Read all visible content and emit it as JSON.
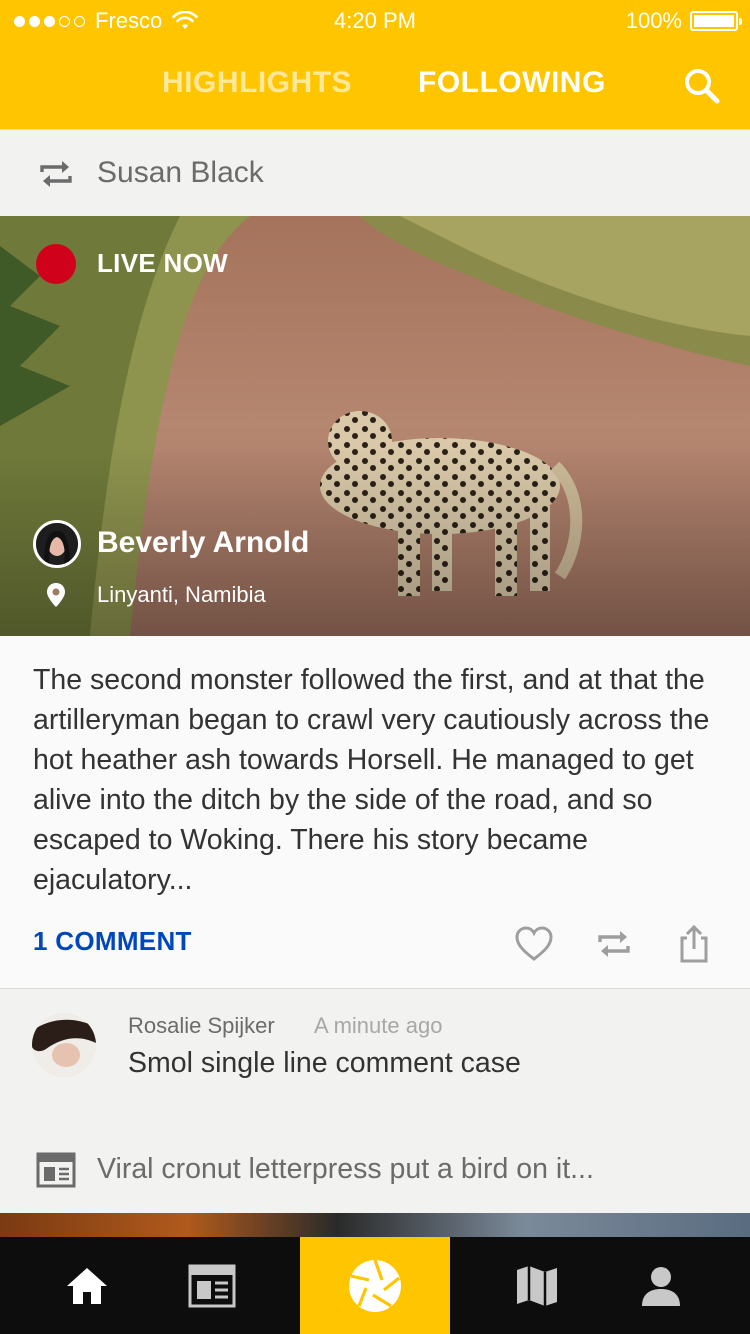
{
  "status_bar": {
    "carrier": "Fresco",
    "time": "4:20 PM",
    "battery": "100%",
    "signal_bars_filled": 3,
    "signal_bars_total": 5,
    "battery_level": 1.0
  },
  "nav": {
    "tabs": [
      {
        "label": "HIGHLIGHTS",
        "active": false
      },
      {
        "label": "FOLLOWING",
        "active": true
      }
    ],
    "search_icon": "search-icon"
  },
  "theme": {
    "accent": "#ffc600",
    "live_red": "#d0021b",
    "link_blue": "#0047bb",
    "tab_bar_bg": "#0d0d0d"
  },
  "post": {
    "reposted_by": "Susan Black",
    "live_label": "LIVE NOW",
    "author": "Beverly Arnold",
    "location": "Linyanti, Namibia",
    "text": "The second monster followed the first, and at that the artilleryman began to crawl very cautiously across the hot heather ash towards Horsell. He managed to get alive into the ditch by the side of the road, and so escaped to Woking. There his story became ejaculatory...",
    "comment_count_label": "1 COMMENT",
    "actions": [
      "heart-icon",
      "repost-icon",
      "share-icon"
    ]
  },
  "comment": {
    "author": "Rosalie Spijker",
    "time": "A minute ago",
    "text": "Smol single line comment case"
  },
  "related_article": {
    "title": "Viral cronut letterpress put a bird on it..."
  },
  "tab_bar": {
    "items": [
      {
        "icon": "home-icon",
        "active": false
      },
      {
        "icon": "news-icon",
        "active": false
      },
      {
        "icon": "camera-shutter-icon",
        "active": true
      },
      {
        "icon": "map-icon",
        "active": false
      },
      {
        "icon": "profile-icon",
        "active": false
      }
    ]
  }
}
